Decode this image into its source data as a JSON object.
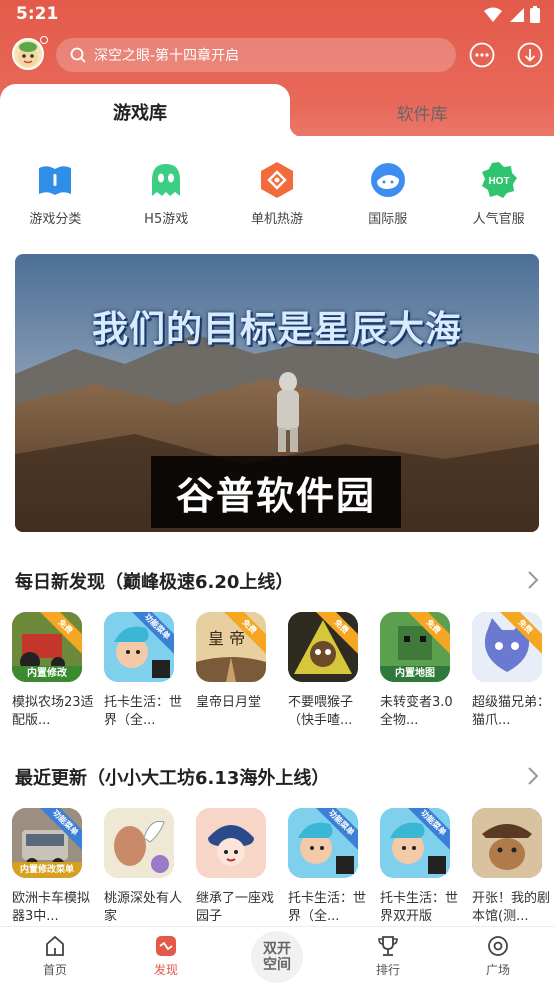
{
  "status_bar": {
    "time": "5:21"
  },
  "header": {
    "search_placeholder": "深空之眼-第十四章开启",
    "accent": "#e35a4a"
  },
  "tabs": [
    {
      "label": "游戏库",
      "active": true
    },
    {
      "label": "软件库",
      "active": false
    }
  ],
  "categories": [
    {
      "label": "游戏分类",
      "icon": "book-icon",
      "color": "#2f8ee8"
    },
    {
      "label": "H5游戏",
      "icon": "ghost-icon",
      "color": "#3ccf83"
    },
    {
      "label": "单机热游",
      "icon": "hexagon-icon",
      "color": "#f26b3a"
    },
    {
      "label": "国际服",
      "icon": "planet-icon",
      "color": "#3d8ef0"
    },
    {
      "label": "人气官服",
      "icon": "hot-badge-icon",
      "color": "#2fc46d"
    }
  ],
  "banner": {
    "headline": "我们的目标是星辰大海",
    "brand": "谷普软件园"
  },
  "sections": [
    {
      "title": "每日新发现（巅峰极速6.20上线）",
      "apps": [
        {
          "name": "模拟农场23适配版...",
          "badge": "免费",
          "corner": "内置修改",
          "color": "#c4362b"
        },
        {
          "name": "托卡生活：世界（全...",
          "badge": "功能菜单",
          "color": "#59c0e0"
        },
        {
          "name": "皇帝日月堂",
          "badge": "免费",
          "color": "#d9a66b"
        },
        {
          "name": "不要喂猴子（快手喳...",
          "badge": "免费",
          "color": "#3d3a2a"
        },
        {
          "name": "未转变者3.0全物...",
          "badge": "免费",
          "corner": "内置地图",
          "color": "#3f8a45"
        },
        {
          "name": "超级猫兄弟：猫爪...",
          "badge": "免费",
          "color": "#7fa0d8"
        }
      ]
    },
    {
      "title": "最近更新（小小大工坊6.13海外上线）",
      "apps": [
        {
          "name": "欧洲卡车模拟器3中...",
          "badge": "功能菜单",
          "corner": "内置修改菜单",
          "color": "#7d7468"
        },
        {
          "name": "桃源深处有人家",
          "badge": "",
          "color": "#e8e0c8"
        },
        {
          "name": "继承了一座戏园子",
          "badge": "",
          "color": "#f2b7a8"
        },
        {
          "name": "托卡生活：世界（全...",
          "badge": "功能菜单",
          "color": "#59c0e0"
        },
        {
          "name": "托卡生活：世界双开版",
          "badge": "功能菜单",
          "color": "#59c0e0"
        },
        {
          "name": "开张！我的剧本馆(测...",
          "badge": "",
          "color": "#8a5a3a"
        }
      ]
    }
  ],
  "bottom_nav": [
    {
      "label": "首页",
      "icon": "home-icon",
      "active": false
    },
    {
      "label": "发现",
      "icon": "discover-icon",
      "active": true
    },
    {
      "label": "双开空间",
      "icon": "dual-space-icon",
      "active": false
    },
    {
      "label": "排行",
      "icon": "trophy-icon",
      "active": false
    },
    {
      "label": "广场",
      "icon": "compass-icon",
      "active": false
    }
  ]
}
